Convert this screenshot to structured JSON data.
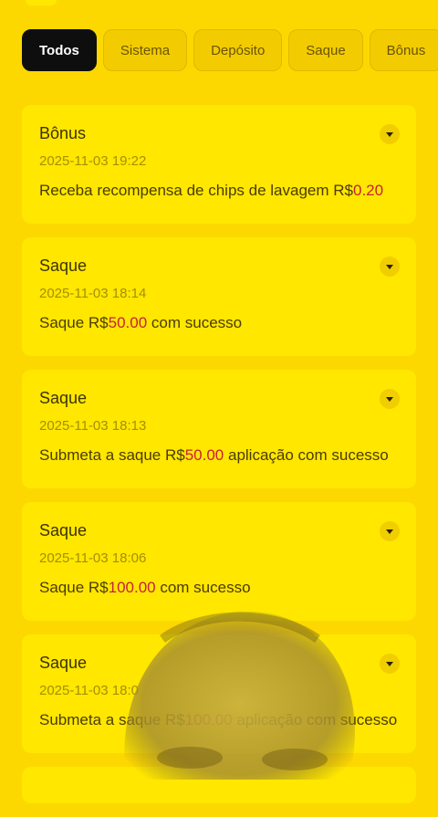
{
  "tabs": [
    {
      "label": "Todos",
      "active": true
    },
    {
      "label": "Sistema",
      "active": false
    },
    {
      "label": "Depósito",
      "active": false
    },
    {
      "label": "Saque",
      "active": false
    },
    {
      "label": "Bônus",
      "active": false
    }
  ],
  "records": [
    {
      "title": "Bônus",
      "time": "2025-11-03 19:22",
      "msg_prefix": "Receba recompensa de chips de lavagem R$",
      "amount": "0.20",
      "msg_suffix": ""
    },
    {
      "title": "Saque",
      "time": "2025-11-03 18:14",
      "msg_prefix": "Saque R$",
      "amount": "50.00",
      "msg_suffix": " com sucesso"
    },
    {
      "title": "Saque",
      "time": "2025-11-03 18:13",
      "msg_prefix": "Submeta a saque R$",
      "amount": "50.00",
      "msg_suffix": " aplicação com sucesso"
    },
    {
      "title": "Saque",
      "time": "2025-11-03 18:06",
      "msg_prefix": "Saque R$",
      "amount": "100.00",
      "msg_suffix": " com sucesso"
    },
    {
      "title": "Saque",
      "time": "2025-11-03 18:0",
      "msg_prefix": "Submeta a saque R$",
      "amount": "100.00",
      "msg_suffix": " aplicação com sucesso"
    }
  ],
  "colors": {
    "background": "#FDD800",
    "card": "#FFE700",
    "active_tab": "#0E0E0E",
    "amount": "#C7203A"
  },
  "icons": {
    "expand": "chevron-down-icon"
  }
}
